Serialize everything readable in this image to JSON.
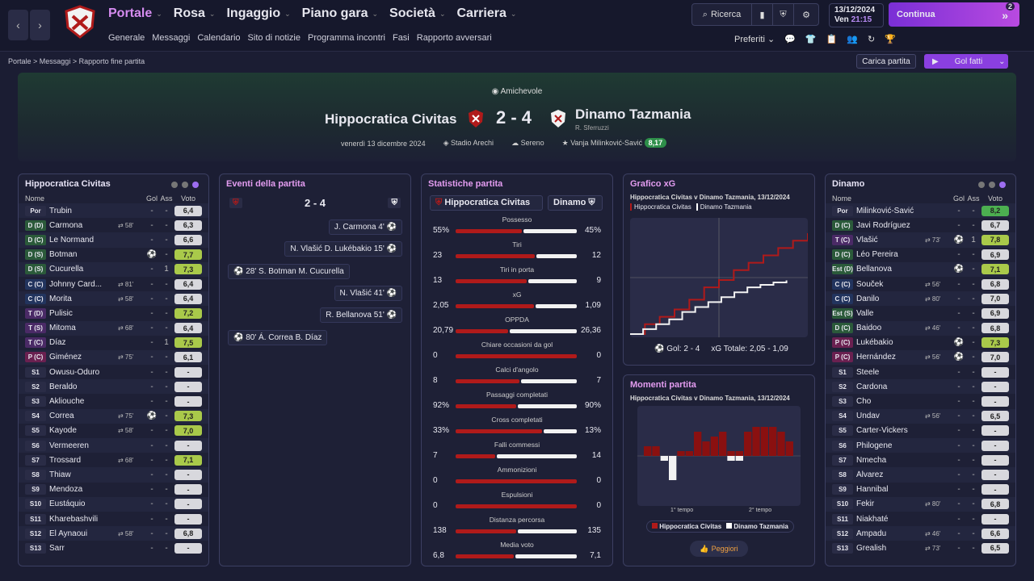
{
  "header": {
    "menu": [
      "Portale",
      "Rosa",
      "Ingaggio",
      "Piano gara",
      "Società",
      "Carriera"
    ],
    "submenu": [
      "Generale",
      "Messaggi",
      "Calendario",
      "Sito di notizie",
      "Programma incontri",
      "Fasi",
      "Rapporto avversari"
    ],
    "search_label": "Ricerca",
    "date": "13/12/2024",
    "day": "Ven",
    "time": "21:15",
    "continue_label": "Continua",
    "notif_count": "2",
    "prefs_label": "Preferiti",
    "pref_badge": "2"
  },
  "breadcrumb": [
    "Portale",
    "Messaggi",
    "Rapporto fine partita"
  ],
  "actions": {
    "load_label": "Carica partita",
    "goals_label": "Gol fatti"
  },
  "match": {
    "competition": "Amichevole",
    "home": "Hippocratica Civitas",
    "away": "Dinamo Tazmania",
    "score": "2 - 4",
    "away_coach": "R. Sferruzzi",
    "date": "venerdì 13 dicembre 2024",
    "stadium": "Stadio Arechi",
    "weather": "Sereno",
    "motm": "Vanja Milinković-Savić",
    "motm_rating": "8,17"
  },
  "home_panel": {
    "title": "Hippocratica Civitas",
    "h_name": "Nome",
    "h_gol": "Gol",
    "h_ass": "Ass",
    "h_voto": "Voto",
    "players": [
      {
        "pos": "Por",
        "pc": "#2a2c46",
        "name": "Trubin",
        "sub": "",
        "gol": "-",
        "ass": "-",
        "vote": "6,4",
        "vc": "#d8d8dd"
      },
      {
        "pos": "D (D)",
        "pc": "#2b5a3a",
        "name": "Carmona",
        "sub": "58'",
        "gol": "-",
        "ass": "-",
        "vote": "6,3",
        "vc": "#d8d8dd"
      },
      {
        "pos": "D (C)",
        "pc": "#2b5a3a",
        "name": "Le Normand",
        "sub": "",
        "gol": "-",
        "ass": "-",
        "vote": "6,6",
        "vc": "#d8d8dd"
      },
      {
        "pos": "D (S)",
        "pc": "#2b5a3a",
        "name": "Botman",
        "sub": "",
        "gol": "⚽",
        "ass": "-",
        "vote": "7,7",
        "vc": "#a9c94a"
      },
      {
        "pos": "D (S)",
        "pc": "#2b5a3a",
        "name": "Cucurella",
        "sub": "",
        "gol": "-",
        "ass": "1",
        "vote": "7,3",
        "vc": "#a9c94a"
      },
      {
        "pos": "C (C)",
        "pc": "#22345e",
        "name": "Johnny Card...",
        "sub": "81'",
        "gol": "-",
        "ass": "-",
        "vote": "6,4",
        "vc": "#d8d8dd"
      },
      {
        "pos": "C (C)",
        "pc": "#22345e",
        "name": "Morita",
        "sub": "58'",
        "gol": "-",
        "ass": "-",
        "vote": "6,4",
        "vc": "#d8d8dd"
      },
      {
        "pos": "T (D)",
        "pc": "#4a2a66",
        "name": "Pulisic",
        "sub": "",
        "gol": "-",
        "ass": "-",
        "vote": "7,2",
        "vc": "#a9c94a"
      },
      {
        "pos": "T (S)",
        "pc": "#4a2a66",
        "name": "Mitoma",
        "sub": "68'",
        "gol": "-",
        "ass": "-",
        "vote": "6,4",
        "vc": "#d8d8dd"
      },
      {
        "pos": "T (C)",
        "pc": "#4a2a66",
        "name": "Díaz",
        "sub": "",
        "gol": "-",
        "ass": "1",
        "vote": "7,5",
        "vc": "#a9c94a"
      },
      {
        "pos": "P (C)",
        "pc": "#6a2050",
        "name": "Giménez",
        "sub": "75'",
        "gol": "-",
        "ass": "-",
        "vote": "6,1",
        "vc": "#d8d8dd"
      },
      {
        "pos": "S1",
        "pc": "#2a2c46",
        "name": "Owusu-Oduro",
        "sub": "",
        "gol": "-",
        "ass": "-",
        "vote": "-",
        "vc": "#d8d8dd"
      },
      {
        "pos": "S2",
        "pc": "#2a2c46",
        "name": "Beraldo",
        "sub": "",
        "gol": "-",
        "ass": "-",
        "vote": "-",
        "vc": "#d8d8dd"
      },
      {
        "pos": "S3",
        "pc": "#2a2c46",
        "name": "Akliouche",
        "sub": "",
        "gol": "-",
        "ass": "-",
        "vote": "-",
        "vc": "#d8d8dd"
      },
      {
        "pos": "S4",
        "pc": "#2a2c46",
        "name": "Correa",
        "sub": "75'",
        "gol": "⚽",
        "ass": "-",
        "vote": "7,3",
        "vc": "#a9c94a"
      },
      {
        "pos": "S5",
        "pc": "#2a2c46",
        "name": "Kayode",
        "sub": "58'",
        "gol": "-",
        "ass": "-",
        "vote": "7,0",
        "vc": "#a9c94a"
      },
      {
        "pos": "S6",
        "pc": "#2a2c46",
        "name": "Vermeeren",
        "sub": "",
        "gol": "-",
        "ass": "-",
        "vote": "-",
        "vc": "#d8d8dd"
      },
      {
        "pos": "S7",
        "pc": "#2a2c46",
        "name": "Trossard",
        "sub": "68'",
        "gol": "-",
        "ass": "-",
        "vote": "7,1",
        "vc": "#a9c94a"
      },
      {
        "pos": "S8",
        "pc": "#2a2c46",
        "name": "Thiaw",
        "sub": "",
        "gol": "-",
        "ass": "-",
        "vote": "-",
        "vc": "#d8d8dd"
      },
      {
        "pos": "S9",
        "pc": "#2a2c46",
        "name": "Mendoza",
        "sub": "",
        "gol": "-",
        "ass": "-",
        "vote": "-",
        "vc": "#d8d8dd"
      },
      {
        "pos": "S10",
        "pc": "#2a2c46",
        "name": "Eustáquio",
        "sub": "",
        "gol": "-",
        "ass": "-",
        "vote": "-",
        "vc": "#d8d8dd"
      },
      {
        "pos": "S11",
        "pc": "#2a2c46",
        "name": "Kharebashvili",
        "sub": "",
        "gol": "-",
        "ass": "-",
        "vote": "-",
        "vc": "#d8d8dd"
      },
      {
        "pos": "S12",
        "pc": "#2a2c46",
        "name": "El Aynaoui",
        "sub": "58'",
        "gol": "-",
        "ass": "-",
        "vote": "6,8",
        "vc": "#d8d8dd"
      },
      {
        "pos": "S13",
        "pc": "#2a2c46",
        "name": "Sarr",
        "sub": "",
        "gol": "-",
        "ass": "-",
        "vote": "-",
        "vc": "#d8d8dd"
      }
    ]
  },
  "away_panel": {
    "title": "Dinamo",
    "h_name": "Nome",
    "h_gol": "Gol",
    "h_ass": "Ass",
    "h_voto": "Voto",
    "players": [
      {
        "pos": "Por",
        "pc": "#2a2c46",
        "name": "Milinković-Savić",
        "sub": "",
        "gol": "-",
        "ass": "-",
        "vote": "8,2",
        "vc": "#4caf50"
      },
      {
        "pos": "D (C)",
        "pc": "#2b5a3a",
        "name": "Javi Rodríguez",
        "sub": "",
        "gol": "-",
        "ass": "-",
        "vote": "6,7",
        "vc": "#d8d8dd"
      },
      {
        "pos": "T (C)",
        "pc": "#4a2a66",
        "name": "Vlašić",
        "sub": "73'",
        "gol": "⚽",
        "ass": "1",
        "vote": "7,8",
        "vc": "#a9c94a"
      },
      {
        "pos": "D (C)",
        "pc": "#2b5a3a",
        "name": "Léo Pereira",
        "sub": "",
        "gol": "-",
        "ass": "-",
        "vote": "6,9",
        "vc": "#d8d8dd"
      },
      {
        "pos": "Est (D)",
        "pc": "#2b5a3a",
        "name": "Bellanova",
        "sub": "",
        "gol": "⚽",
        "ass": "-",
        "vote": "7,1",
        "vc": "#a9c94a"
      },
      {
        "pos": "C (C)",
        "pc": "#22345e",
        "name": "Souček",
        "sub": "56'",
        "gol": "-",
        "ass": "-",
        "vote": "6,8",
        "vc": "#d8d8dd"
      },
      {
        "pos": "C (C)",
        "pc": "#22345e",
        "name": "Danilo",
        "sub": "80'",
        "gol": "-",
        "ass": "-",
        "vote": "7,0",
        "vc": "#d8d8dd"
      },
      {
        "pos": "Est (S)",
        "pc": "#2b5a3a",
        "name": "Valle",
        "sub": "",
        "gol": "-",
        "ass": "-",
        "vote": "6,9",
        "vc": "#d8d8dd"
      },
      {
        "pos": "D (C)",
        "pc": "#2b5a3a",
        "name": "Baidoo",
        "sub": "46'",
        "gol": "-",
        "ass": "-",
        "vote": "6,8",
        "vc": "#d8d8dd"
      },
      {
        "pos": "P (C)",
        "pc": "#6a2050",
        "name": "Lukébakio",
        "sub": "",
        "gol": "⚽",
        "ass": "-",
        "vote": "7,3",
        "vc": "#a9c94a"
      },
      {
        "pos": "P (C)",
        "pc": "#6a2050",
        "name": "Hernández",
        "sub": "56'",
        "gol": "⚽",
        "ass": "-",
        "vote": "7,0",
        "vc": "#d8d8dd"
      },
      {
        "pos": "S1",
        "pc": "#2a2c46",
        "name": "Steele",
        "sub": "",
        "gol": "-",
        "ass": "-",
        "vote": "-",
        "vc": "#d8d8dd"
      },
      {
        "pos": "S2",
        "pc": "#2a2c46",
        "name": "Cardona",
        "sub": "",
        "gol": "-",
        "ass": "-",
        "vote": "-",
        "vc": "#d8d8dd"
      },
      {
        "pos": "S3",
        "pc": "#2a2c46",
        "name": "Cho",
        "sub": "",
        "gol": "-",
        "ass": "-",
        "vote": "-",
        "vc": "#d8d8dd"
      },
      {
        "pos": "S4",
        "pc": "#2a2c46",
        "name": "Undav",
        "sub": "56'",
        "gol": "-",
        "ass": "-",
        "vote": "6,5",
        "vc": "#d8d8dd"
      },
      {
        "pos": "S5",
        "pc": "#2a2c46",
        "name": "Carter-Vickers",
        "sub": "",
        "gol": "-",
        "ass": "-",
        "vote": "-",
        "vc": "#d8d8dd"
      },
      {
        "pos": "S6",
        "pc": "#2a2c46",
        "name": "Philogene",
        "sub": "",
        "gol": "-",
        "ass": "-",
        "vote": "-",
        "vc": "#d8d8dd"
      },
      {
        "pos": "S7",
        "pc": "#2a2c46",
        "name": "Nmecha",
        "sub": "",
        "gol": "-",
        "ass": "-",
        "vote": "-",
        "vc": "#d8d8dd"
      },
      {
        "pos": "S8",
        "pc": "#2a2c46",
        "name": "Álvarez",
        "sub": "",
        "gol": "-",
        "ass": "-",
        "vote": "-",
        "vc": "#d8d8dd"
      },
      {
        "pos": "S9",
        "pc": "#2a2c46",
        "name": "Hannibal",
        "sub": "",
        "gol": "-",
        "ass": "-",
        "vote": "-",
        "vc": "#d8d8dd"
      },
      {
        "pos": "S10",
        "pc": "#2a2c46",
        "name": "Fekir",
        "sub": "80'",
        "gol": "-",
        "ass": "-",
        "vote": "6,8",
        "vc": "#d8d8dd"
      },
      {
        "pos": "S11",
        "pc": "#2a2c46",
        "name": "Niakhaté",
        "sub": "",
        "gol": "-",
        "ass": "-",
        "vote": "-",
        "vc": "#d8d8dd"
      },
      {
        "pos": "S12",
        "pc": "#2a2c46",
        "name": "Ampadu",
        "sub": "46'",
        "gol": "-",
        "ass": "-",
        "vote": "6,6",
        "vc": "#d8d8dd"
      },
      {
        "pos": "S13",
        "pc": "#2a2c46",
        "name": "Grealish",
        "sub": "73'",
        "gol": "-",
        "ass": "-",
        "vote": "6,5",
        "vc": "#d8d8dd"
      }
    ]
  },
  "events": {
    "title": "Eventi della partita",
    "score": "2 - 4",
    "items": [
      {
        "text": "J. Carmona 4'",
        "side": "right"
      },
      {
        "text": "N. Vlašić D. Lukébakio 15'",
        "side": "right"
      },
      {
        "text": "28' S. Botman M. Cucurella",
        "side": "left"
      },
      {
        "text": "N. Vlašić 41'",
        "side": "right"
      },
      {
        "text": "R. Bellanova 51'",
        "side": "right"
      },
      {
        "text": "80' Á. Correa B. Díaz",
        "side": "left"
      }
    ]
  },
  "stats": {
    "title": "Statistiche partita",
    "home": "Hippocratica Civitas",
    "away": "Dinamo",
    "rows": [
      {
        "label": "Possesso",
        "l": "55%",
        "r": "45%",
        "lv": 55,
        "rv": 45
      },
      {
        "label": "Tiri",
        "l": "23",
        "r": "12",
        "lv": 23,
        "rv": 12
      },
      {
        "label": "Tiri in porta",
        "l": "13",
        "r": "9",
        "lv": 13,
        "rv": 9
      },
      {
        "label": "xG",
        "l": "2,05",
        "r": "1,09",
        "lv": 2.05,
        "rv": 1.09
      },
      {
        "label": "OPPDA",
        "l": "20,79",
        "r": "26,36",
        "lv": 20.79,
        "rv": 26.36
      },
      {
        "label": "Chiare occasioni da gol",
        "l": "0",
        "r": "0",
        "lv": 1,
        "rv": 0
      },
      {
        "label": "Calci d'angolo",
        "l": "8",
        "r": "7",
        "lv": 8,
        "rv": 7
      },
      {
        "label": "Passaggi completati",
        "l": "92%",
        "r": "90%",
        "lv": 92,
        "rv": 90
      },
      {
        "label": "Cross completati",
        "l": "33%",
        "r": "13%",
        "lv": 33,
        "rv": 13
      },
      {
        "label": "Falli commessi",
        "l": "7",
        "r": "14",
        "lv": 7,
        "rv": 14
      },
      {
        "label": "Ammonizioni",
        "l": "0",
        "r": "0",
        "lv": 1,
        "rv": 0
      },
      {
        "label": "Espulsioni",
        "l": "0",
        "r": "0",
        "lv": 1,
        "rv": 0
      },
      {
        "label": "Distanza percorsa",
        "l": "138",
        "r": "135",
        "lv": 138,
        "rv": 135
      },
      {
        "label": "Media voto",
        "l": "6,8",
        "r": "7,1",
        "lv": 6.8,
        "rv": 7.1
      }
    ]
  },
  "xg": {
    "title": "Grafico xG",
    "subtitle": "Hippocratica Civitas v Dinamo Tazmania, 13/12/2024",
    "legend_home": "Hippocratica Civitas",
    "legend_away": "Dinamo Tazmania",
    "footer_goals": "Gol: 2 - 4",
    "footer_xg": "xG Totale: 2,05 - 1,09"
  },
  "moments": {
    "title": "Momenti partita",
    "subtitle": "Hippocratica Civitas v Dinamo Tazmania, 13/12/2024",
    "half1": "1° tempo",
    "half2": "2° tempo",
    "legend_home": "Hippocratica Civitas",
    "legend_away": "Dinamo Tazmania",
    "worst_btn": "Peggiori"
  },
  "chart_data": [
    {
      "type": "line",
      "title": "Grafico xG",
      "series": [
        {
          "name": "Hippocratica Civitas",
          "values": [
            0,
            0.2,
            0.35,
            0.5,
            0.7,
            0.95,
            1.1,
            1.3,
            1.45,
            1.6,
            1.75,
            1.9,
            2.05
          ]
        },
        {
          "name": "Dinamo Tazmania",
          "values": [
            0,
            0.1,
            0.2,
            0.3,
            0.45,
            0.55,
            0.65,
            0.75,
            0.85,
            0.95,
            1.0,
            1.05,
            1.09
          ]
        }
      ]
    },
    {
      "type": "bar",
      "title": "Momenti partita",
      "series": [
        {
          "name": "Hippocratica Civitas",
          "values": [
            2,
            2,
            0,
            0,
            1,
            1,
            5,
            3,
            4,
            5,
            1,
            1,
            5,
            6,
            6,
            6,
            5,
            3
          ]
        },
        {
          "name": "Dinamo Tazmania",
          "values": [
            0,
            0,
            1,
            5,
            0,
            0,
            0,
            0,
            0,
            0,
            1,
            1,
            0,
            0,
            0,
            0,
            0,
            0
          ]
        }
      ]
    }
  ],
  "colors": {
    "accent": "#8a3fe0",
    "home": "#b01a1a",
    "away": "#f2f2f2"
  }
}
